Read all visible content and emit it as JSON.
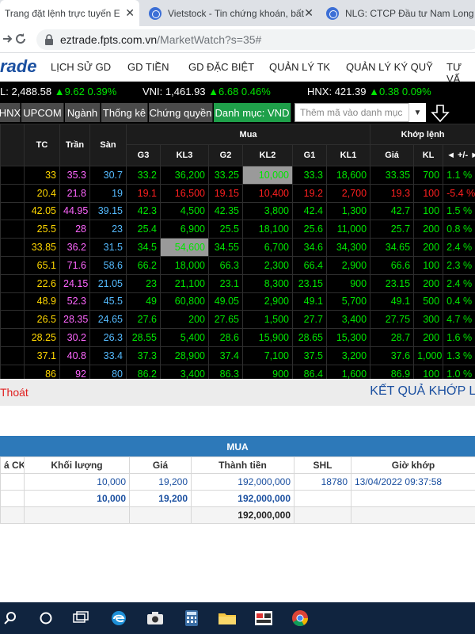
{
  "browser": {
    "tabs": [
      {
        "title": "Trang đặt lệnh trực tuyến EzTr",
        "close": "✕"
      },
      {
        "title": "Vietstock - Tin chứng khoán, bất",
        "close": "✕"
      },
      {
        "title": "NLG: CTCP Đầu tư Nam Long - N",
        "close": ""
      }
    ],
    "url_host": "eztrade.fpts.com.vn",
    "url_path": "/MarketWatch?s=35#"
  },
  "site": {
    "logo": "rade",
    "nav": [
      "LỊCH SỬ GD",
      "GD TIỀN",
      "GD ĐẶC BIỆT",
      "QUẢN LÝ TK",
      "QUẢN LÝ KÝ QUỸ",
      "TƯ VẤ"
    ]
  },
  "ticker": [
    {
      "label": "L:",
      "value": "2,488.58",
      "change": "▲9.62 0.39%"
    },
    {
      "label": "VNI:",
      "value": "1,461.93",
      "change": "▲6.68 0.46%"
    },
    {
      "label": "HNX:",
      "value": "421.39",
      "change": "▲0.38 0.09%"
    }
  ],
  "board_tabs": [
    "HNX",
    "UPCOM",
    "Ngành",
    "Thống kê",
    "Chứng quyền",
    "Danh mục: VND"
  ],
  "add_placeholder": "Thêm mã vào danh mục",
  "board": {
    "group_headers": {
      "buy": "Mua",
      "match": "Khớp lệnh"
    },
    "columns": [
      "TC",
      "Trần",
      "Sàn",
      "G3",
      "KL3",
      "G2",
      "KL2",
      "G1",
      "KL1",
      "Giá",
      "KL",
      "◄ +/- ►"
    ],
    "rows": [
      {
        "tc": "33",
        "tran": "35.3",
        "san": "30.7",
        "g3": "33.2",
        "kl3": "36,200",
        "g2": "33.25",
        "kl2": "10,000",
        "g1": "33.3",
        "kl1": "18,600",
        "gia": "33.35",
        "kl": "700",
        "pct": "1.1 %",
        "dir": "up",
        "hl": "kl2"
      },
      {
        "tc": "20.4",
        "tran": "21.8",
        "san": "19",
        "g3": "19.1",
        "kl3": "16,500",
        "g2": "19.15",
        "kl2": "10,400",
        "g1": "19.2",
        "kl1": "2,700",
        "gia": "19.3",
        "kl": "100",
        "pct": "-5.4 %",
        "dir": "dn",
        "hl": ""
      },
      {
        "tc": "42.05",
        "tran": "44.95",
        "san": "39.15",
        "g3": "42.3",
        "kl3": "4,500",
        "g2": "42.35",
        "kl2": "3,800",
        "g1": "42.4",
        "kl1": "1,300",
        "gia": "42.7",
        "kl": "100",
        "pct": "1.5 %",
        "dir": "up",
        "hl": ""
      },
      {
        "tc": "25.5",
        "tran": "28",
        "san": "23",
        "g3": "25.4",
        "kl3": "6,900",
        "g2": "25.5",
        "kl2": "18,100",
        "g1": "25.6",
        "kl1": "11,000",
        "gia": "25.7",
        "kl": "200",
        "pct": "0.8 %",
        "dir": "up",
        "hl": ""
      },
      {
        "tc": "33.85",
        "tran": "36.2",
        "san": "31.5",
        "g3": "34.5",
        "kl3": "54,600",
        "g2": "34.55",
        "kl2": "6,700",
        "g1": "34.6",
        "kl1": "34,300",
        "gia": "34.65",
        "kl": "200",
        "pct": "2.4 %",
        "dir": "up",
        "hl": "kl3"
      },
      {
        "tc": "65.1",
        "tran": "71.6",
        "san": "58.6",
        "g3": "66.2",
        "kl3": "18,000",
        "g2": "66.3",
        "kl2": "2,300",
        "g1": "66.4",
        "kl1": "2,900",
        "gia": "66.6",
        "kl": "100",
        "pct": "2.3 %",
        "dir": "up",
        "hl": ""
      },
      {
        "tc": "22.6",
        "tran": "24.15",
        "san": "21.05",
        "g3": "23",
        "kl3": "21,100",
        "g2": "23.1",
        "kl2": "8,300",
        "g1": "23.15",
        "kl1": "900",
        "gia": "23.15",
        "kl": "200",
        "pct": "2.4 %",
        "dir": "up",
        "hl": ""
      },
      {
        "tc": "48.9",
        "tran": "52.3",
        "san": "45.5",
        "g3": "49",
        "kl3": "60,800",
        "g2": "49.05",
        "kl2": "2,900",
        "g1": "49.1",
        "kl1": "5,700",
        "gia": "49.1",
        "kl": "500",
        "pct": "0.4 %",
        "dir": "up",
        "hl": ""
      },
      {
        "tc": "26.5",
        "tran": "28.35",
        "san": "24.65",
        "g3": "27.6",
        "kl3": "200",
        "g2": "27.65",
        "kl2": "1,500",
        "g1": "27.7",
        "kl1": "3,400",
        "gia": "27.75",
        "kl": "300",
        "pct": "4.7 %",
        "dir": "up",
        "hl": ""
      },
      {
        "tc": "28.25",
        "tran": "30.2",
        "san": "26.3",
        "g3": "28.55",
        "kl3": "5,400",
        "g2": "28.6",
        "kl2": "15,900",
        "g1": "28.65",
        "kl1": "15,300",
        "gia": "28.7",
        "kl": "200",
        "pct": "1.6 %",
        "dir": "up",
        "hl": ""
      },
      {
        "tc": "37.1",
        "tran": "40.8",
        "san": "33.4",
        "g3": "37.3",
        "kl3": "28,900",
        "g2": "37.4",
        "kl2": "7,100",
        "g1": "37.5",
        "kl1": "3,200",
        "gia": "37.6",
        "kl": "1,000",
        "pct": "1.3 %",
        "dir": "up",
        "hl": ""
      },
      {
        "tc": "86",
        "tran": "92",
        "san": "80",
        "g3": "86.2",
        "kl3": "3,400",
        "g2": "86.3",
        "kl2": "900",
        "g1": "86.4",
        "kl1": "1,600",
        "gia": "86.9",
        "kl": "100",
        "pct": "1.0 %",
        "dir": "up",
        "hl": ""
      }
    ]
  },
  "actions": {
    "logout": "Thoát",
    "results_title": "KẾT QUẢ KHỚP LỆ"
  },
  "results": {
    "section": "MUA",
    "columns": [
      "á CK",
      "Khối lượng",
      "Giá",
      "Thành tiền",
      "SHL",
      "Giờ khớp"
    ],
    "row": {
      "qty": "10,000",
      "price": "19,200",
      "amount": "192,000,000",
      "shl": "18780",
      "time": "13/04/2022 09:37:58"
    },
    "subtotal": {
      "qty": "10,000",
      "price": "19,200",
      "amount": "192,000,000"
    },
    "grand_total": "192,000,000"
  },
  "taskbar": [
    "search-icon",
    "task-view-icon",
    "file-explorer-icon",
    "edge-icon",
    "camera-icon",
    "calculator-icon",
    "folder-icon",
    "app-icon",
    "chrome-icon"
  ],
  "colors": {
    "ref": "#ffd700",
    "ceiling": "#ff66ff",
    "floor": "#55bbff",
    "up": "#00e600",
    "down": "#ff2020",
    "accent": "#1fa04a",
    "header_blue": "#2d79b9"
  }
}
